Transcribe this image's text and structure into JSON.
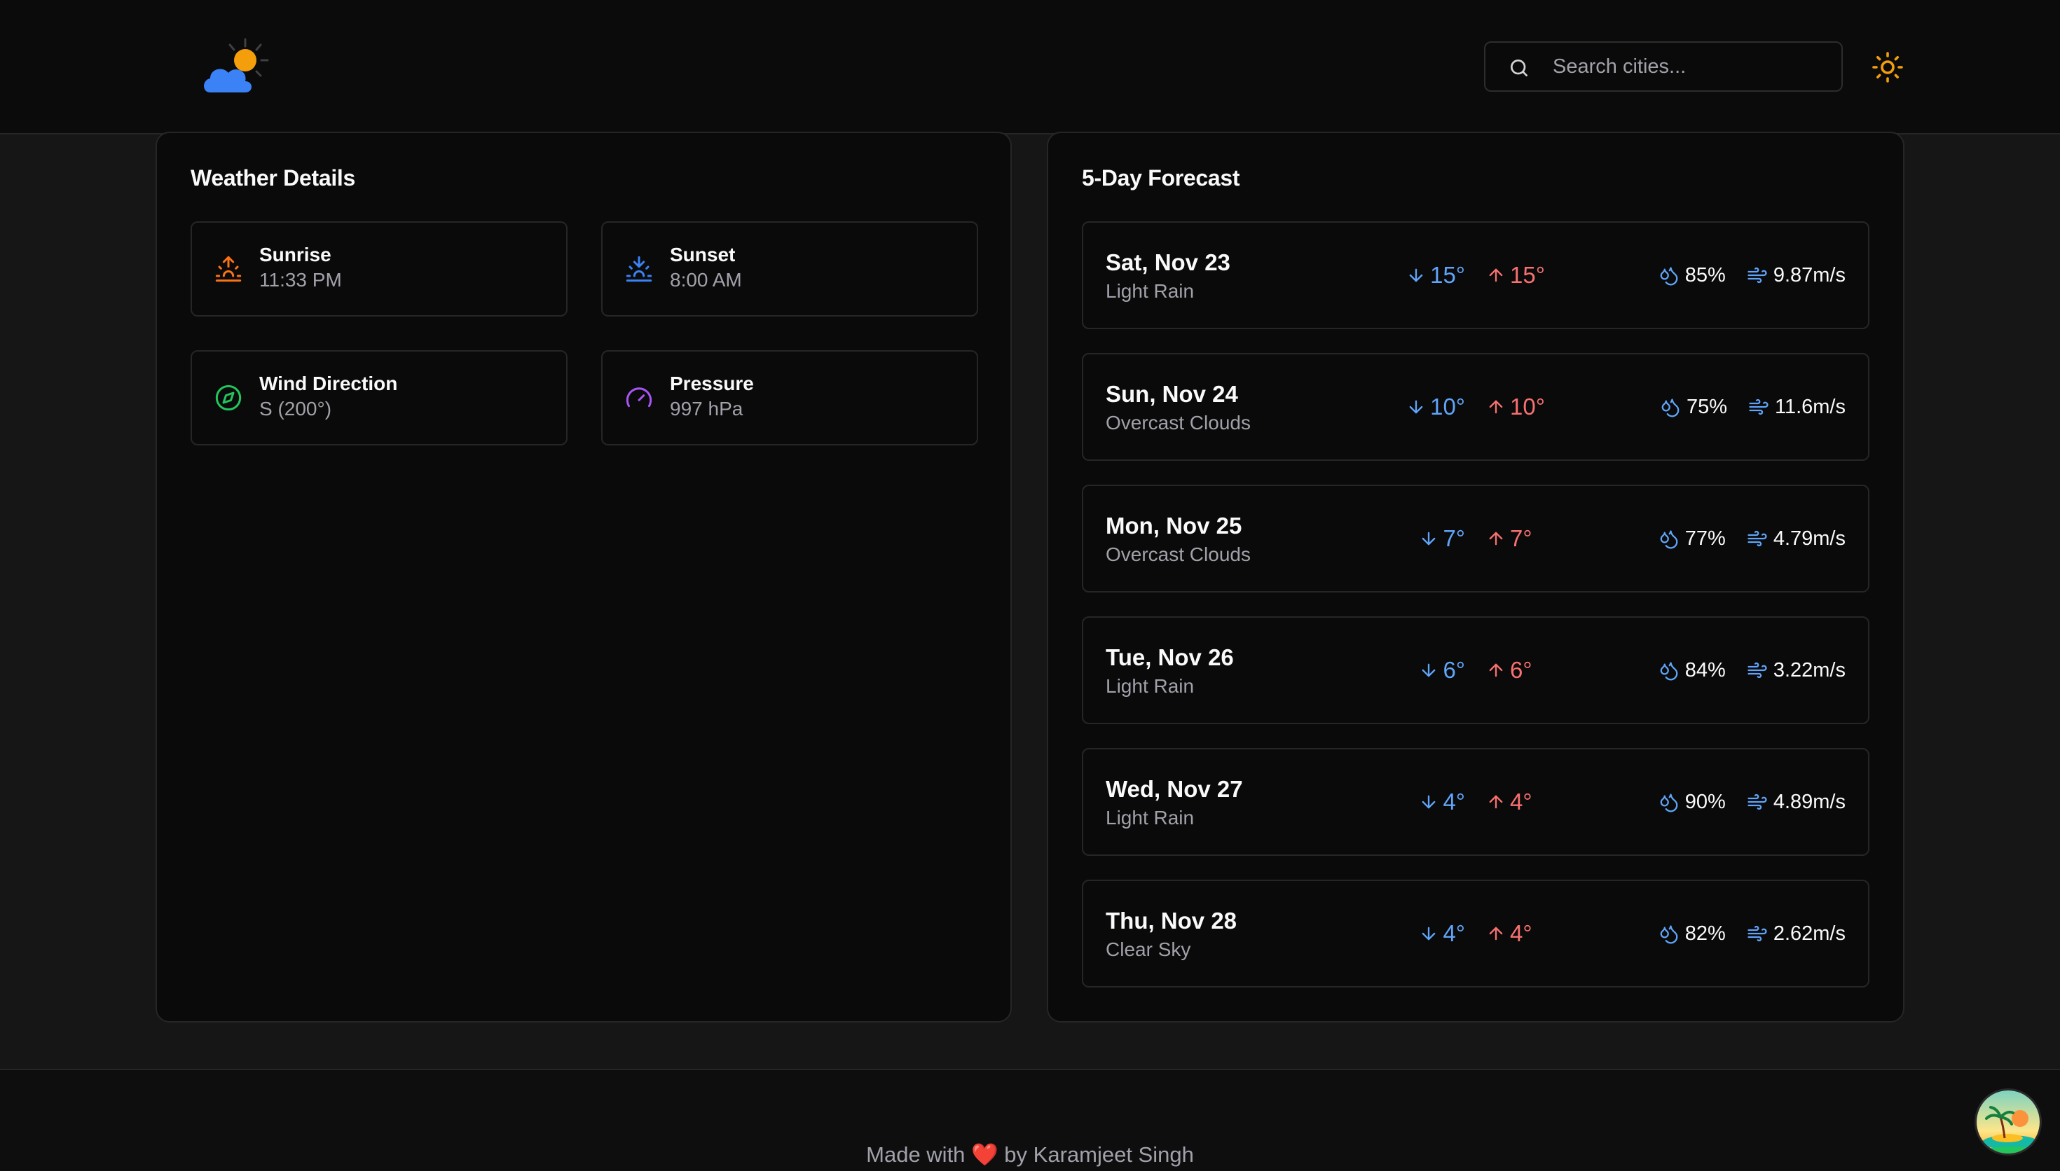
{
  "header": {
    "logo_icon": "cloud-sun-icon",
    "search": {
      "placeholder": "Search cities...",
      "value": ""
    },
    "theme_toggle_icon": "sun-icon"
  },
  "details": {
    "title": "Weather Details",
    "items": [
      {
        "label": "Sunrise",
        "value": "11:33 PM",
        "icon": "sunrise-icon",
        "color": "#f97316"
      },
      {
        "label": "Sunset",
        "value": "8:00 AM",
        "icon": "sunset-icon",
        "color": "#3b82f6"
      },
      {
        "label": "Wind Direction",
        "value": "S (200°)",
        "icon": "compass-icon",
        "color": "#22c55e"
      },
      {
        "label": "Pressure",
        "value": "997 hPa",
        "icon": "gauge-icon",
        "color": "#a855f7"
      }
    ]
  },
  "forecast": {
    "title": "5-Day Forecast",
    "days": [
      {
        "date": "Sat, Nov 23",
        "desc": "Light Rain",
        "min": "15°",
        "max": "15°",
        "humidity": "85%",
        "wind": "9.87m/s"
      },
      {
        "date": "Sun, Nov 24",
        "desc": "Overcast Clouds",
        "min": "10°",
        "max": "10°",
        "humidity": "75%",
        "wind": "11.6m/s"
      },
      {
        "date": "Mon, Nov 25",
        "desc": "Overcast Clouds",
        "min": "7°",
        "max": "7°",
        "humidity": "77%",
        "wind": "4.79m/s"
      },
      {
        "date": "Tue, Nov 26",
        "desc": "Light Rain",
        "min": "6°",
        "max": "6°",
        "humidity": "84%",
        "wind": "3.22m/s"
      },
      {
        "date": "Wed, Nov 27",
        "desc": "Light Rain",
        "min": "4°",
        "max": "4°",
        "humidity": "90%",
        "wind": "4.89m/s"
      },
      {
        "date": "Thu, Nov 28",
        "desc": "Clear Sky",
        "min": "4°",
        "max": "4°",
        "humidity": "82%",
        "wind": "2.62m/s"
      }
    ]
  },
  "footer": {
    "prefix": "Made with",
    "heart": "❤️",
    "suffix": "by Karamjeet Singh"
  },
  "colors": {
    "min_temp": "#60a5fa",
    "max_temp": "#f87171",
    "accent_sun": "#f59e0b"
  }
}
